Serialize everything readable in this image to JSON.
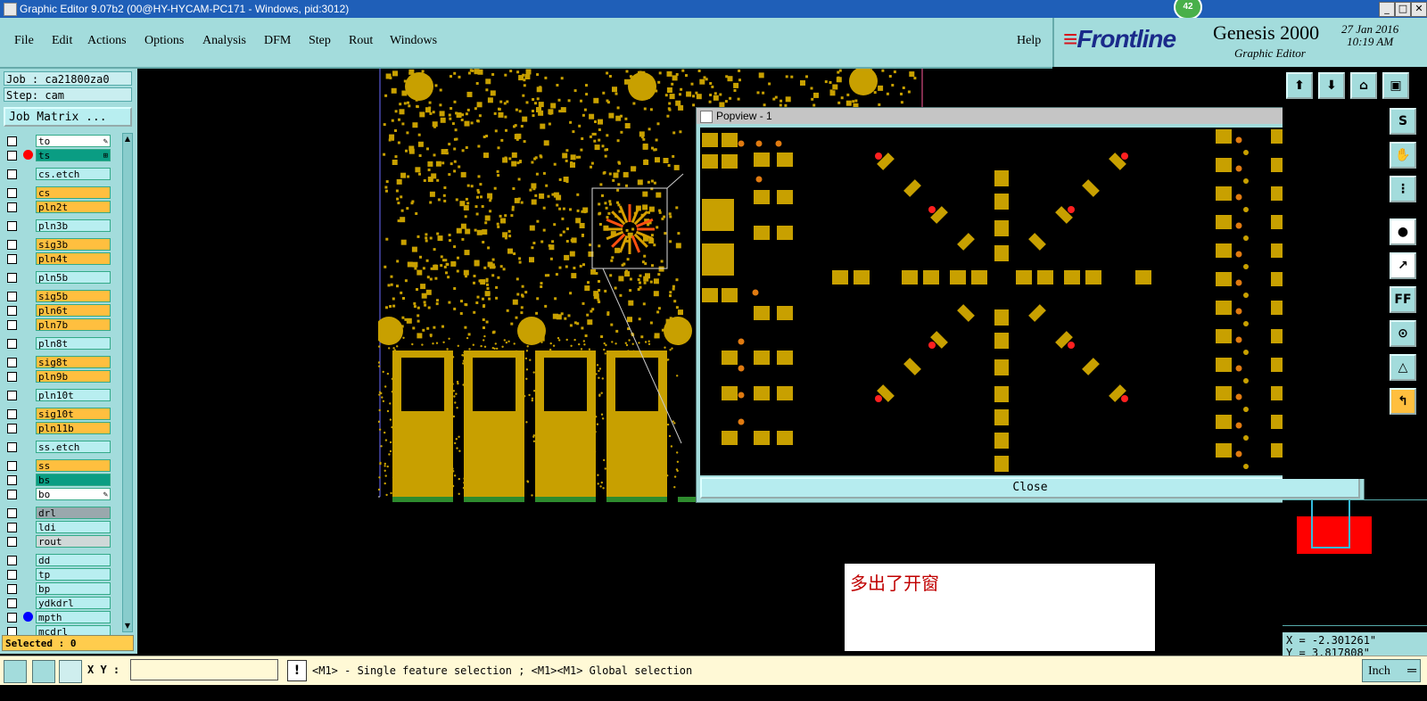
{
  "window": {
    "title": "Graphic Editor 9.07b2 (00@HY-HYCAM-PC171 - Windows, pid:3012)",
    "notification_count": "42",
    "minimize": "_",
    "maximize": "□",
    "close": "✕"
  },
  "menubar": {
    "items": [
      "File",
      "Edit",
      "Actions",
      "Options",
      "Analysis",
      "DFM",
      "Step",
      "Rout",
      "Windows"
    ],
    "help": "Help"
  },
  "branding": {
    "logo_text": "Frontline",
    "product": "Genesis 2000",
    "subtitle": "Graphic Editor",
    "date": "27 Jan 2016",
    "time": "10:19 AM"
  },
  "job": {
    "job_line": "Job : ca21800za0",
    "step_line": "Step: cam",
    "job_matrix_button": "Job Matrix ..."
  },
  "layers": [
    {
      "name": "to",
      "color": "#ffffff",
      "marker": "",
      "flag": "✎"
    },
    {
      "name": "ts",
      "color": "#0a9d83",
      "marker": "#ff0000",
      "flag": "⊞",
      "selected": true
    },
    {
      "name": "cs.etch",
      "color": "#b8eef0",
      "marker": ""
    },
    {
      "name": "cs",
      "color": "#ffbf3f",
      "marker": ""
    },
    {
      "name": "pln2t",
      "color": "#ffbf3f",
      "marker": ""
    },
    {
      "name": "pln3b",
      "color": "#b8eef0",
      "marker": ""
    },
    {
      "name": "sig3b",
      "color": "#ffbf3f",
      "marker": ""
    },
    {
      "name": "pln4t",
      "color": "#ffbf3f",
      "marker": ""
    },
    {
      "name": "pln5b",
      "color": "#b8eef0",
      "marker": ""
    },
    {
      "name": "sig5b",
      "color": "#ffbf3f",
      "marker": ""
    },
    {
      "name": "pln6t",
      "color": "#ffbf3f",
      "marker": ""
    },
    {
      "name": "pln7b",
      "color": "#ffbf3f",
      "marker": ""
    },
    {
      "name": "pln8t",
      "color": "#b8eef0",
      "marker": ""
    },
    {
      "name": "sig8t",
      "color": "#ffbf3f",
      "marker": ""
    },
    {
      "name": "pln9b",
      "color": "#ffbf3f",
      "marker": ""
    },
    {
      "name": "pln10t",
      "color": "#b8eef0",
      "marker": ""
    },
    {
      "name": "sig10t",
      "color": "#ffbf3f",
      "marker": ""
    },
    {
      "name": "pln11b",
      "color": "#ffbf3f",
      "marker": ""
    },
    {
      "name": "ss.etch",
      "color": "#b8eef0",
      "marker": ""
    },
    {
      "name": "ss",
      "color": "#ffbf3f",
      "marker": ""
    },
    {
      "name": "bs",
      "color": "#0a9d83",
      "marker": ""
    },
    {
      "name": "bo",
      "color": "#ffffff",
      "marker": "",
      "flag": "✎"
    },
    {
      "name": "drl",
      "color": "#9aa8ad",
      "marker": ""
    },
    {
      "name": "ldi",
      "color": "#b8eef0",
      "marker": ""
    },
    {
      "name": "rout",
      "color": "#cfd8d8",
      "marker": ""
    },
    {
      "name": "dd",
      "color": "#b8eef0",
      "marker": ""
    },
    {
      "name": "tp",
      "color": "#b8eef0",
      "marker": ""
    },
    {
      "name": "bp",
      "color": "#b8eef0",
      "marker": ""
    },
    {
      "name": "ydkdrl",
      "color": "#b8eef0",
      "marker": ""
    },
    {
      "name": "mpth",
      "color": "#b8eef0",
      "marker": "#0000ff"
    },
    {
      "name": "mcdrl",
      "color": "#b8eef0",
      "marker": ""
    }
  ],
  "selected_status": "Selected : 0",
  "bottombar": {
    "xy_label": "X Y :",
    "xy_value": "",
    "warn": "!",
    "hint": "<M1> - Single feature selection ; <M1><M1> Global selection",
    "units": "Inch"
  },
  "coords": {
    "x": "X = -2.301261\"",
    "y": "Y = 3.817808\""
  },
  "popview": {
    "title": "Popview - 1",
    "close_label": "Close",
    "close_x": "✕"
  },
  "annotation": {
    "text": "多出了开窗"
  },
  "colors": {
    "panel": "#a3dcdc",
    "pad": "#c8a000",
    "highlight_red": "#ff2020",
    "titlebar": "#1f5fb8"
  }
}
